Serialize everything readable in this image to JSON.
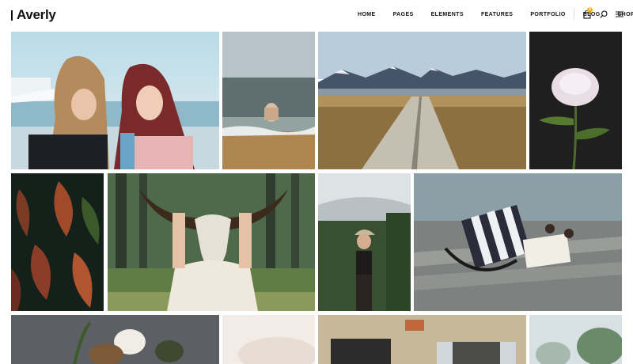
{
  "brand": {
    "name": "Averly"
  },
  "nav": {
    "items": [
      "HOME",
      "PAGES",
      "ELEMENTS",
      "FEATURES",
      "PORTFOLIO",
      "BLOG",
      "SHOP"
    ]
  },
  "cart": {
    "count": "0"
  },
  "icons": {
    "cart": "shopping-bag-icon",
    "search": "search-icon",
    "menu": "hamburger-menu-icon"
  },
  "gallery": {
    "items": [
      {
        "name": "two-women-beach-photo"
      },
      {
        "name": "couple-in-sea-photo"
      },
      {
        "name": "mountain-boardwalk-photo"
      },
      {
        "name": "white-peony-photo"
      },
      {
        "name": "croton-leaves-photo"
      },
      {
        "name": "woman-holding-skull-photo"
      },
      {
        "name": "woman-in-greenhouse-photo"
      },
      {
        "name": "striped-bag-on-dock-photo"
      },
      {
        "name": "flower-arrangement-photo"
      },
      {
        "name": "soft-fabric-photo"
      },
      {
        "name": "stone-house-photo"
      },
      {
        "name": "blurred-foliage-photo"
      }
    ]
  },
  "colors": {
    "accent": "#f2b705",
    "text": "#111111"
  }
}
